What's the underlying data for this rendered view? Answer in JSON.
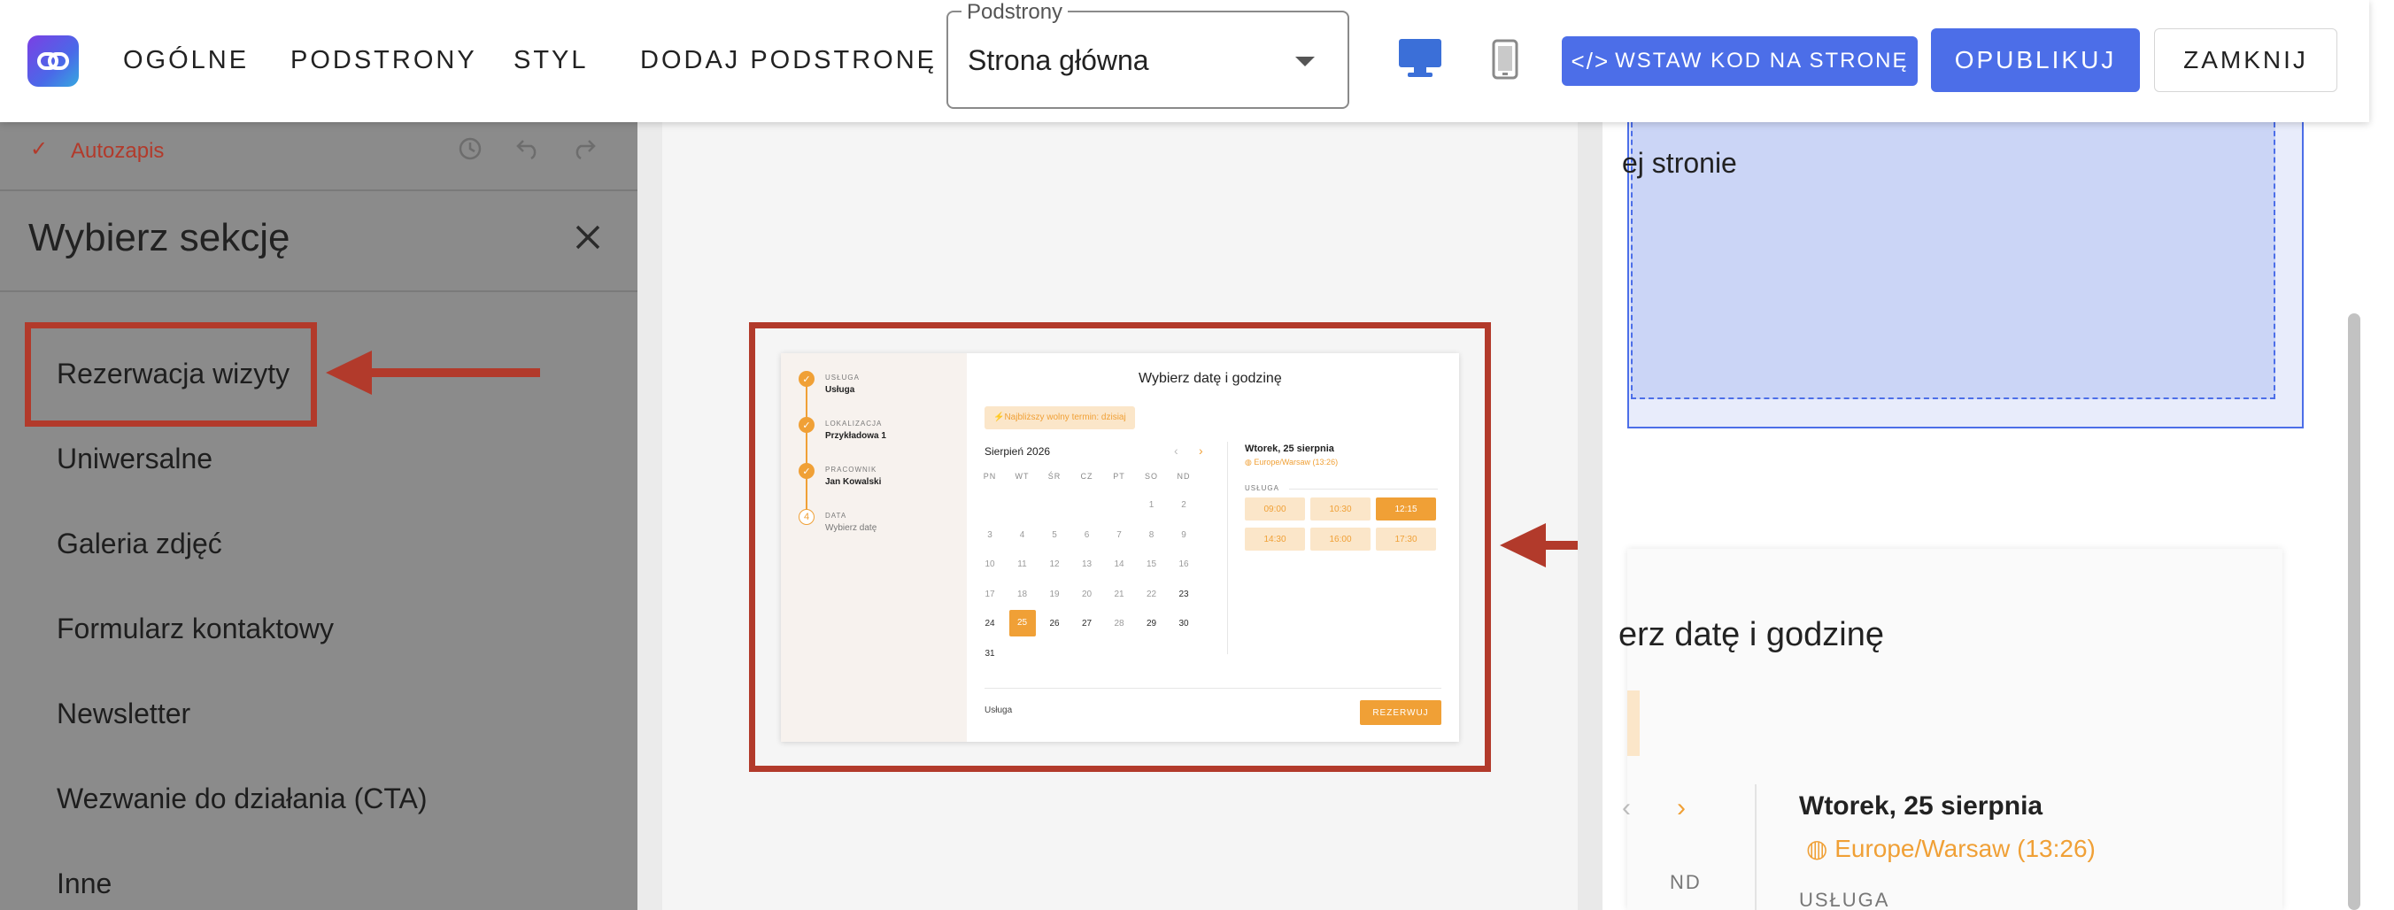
{
  "topbar": {
    "nav": [
      "OGÓLNE",
      "PODSTRONY",
      "STYL",
      "DODAJ PODSTRONĘ"
    ],
    "select_legend": "Podstrony",
    "select_value": "Strona główna",
    "embed_label": "WSTAW KOD NA STRONĘ",
    "publish_label": "OPUBLIKUJ",
    "close_label": "ZAMKNIJ"
  },
  "sidebar": {
    "autosave": "Autozapis",
    "title": "Wybierz sekcję",
    "items": [
      "Rezerwacja wizyty",
      "Uniwersalne",
      "Galeria zdjęć",
      "Formularz kontaktowy",
      "Newsletter",
      "Wezwanie do działania (CTA)",
      "Inne"
    ]
  },
  "preview": {
    "steps": [
      {
        "label": "USŁUGA",
        "value": "Usługa"
      },
      {
        "label": "LOKALIZACJA",
        "value": "Przykładowa 1"
      },
      {
        "label": "PRACOWNIK",
        "value": "Jan Kowalski"
      },
      {
        "label": "DATA",
        "value": "Wybierz datę",
        "num": "4"
      }
    ],
    "title": "Wybierz datę i godzinę",
    "nearest": "⚡Najbliższy wolny termin: dzisiaj",
    "month": "Sierpień 2026",
    "weekdays": [
      "PN",
      "WT",
      "ŚR",
      "CZ",
      "PT",
      "SO",
      "ND"
    ],
    "selected_date": "Wtorek, 25 sierpnia",
    "timezone": "Europe/Warsaw (13:26)",
    "service_label": "USŁUGA",
    "slots": [
      "09:00",
      "10:30",
      "12:15",
      "14:30",
      "16:00",
      "17:30"
    ],
    "footer_label": "Usługa",
    "reserve_label": "REZERWUJ"
  },
  "right_panel": {
    "text_fragment": "ej stronie",
    "heading_fragment": "erz datę i godzinę",
    "weekday_fragment": "ND",
    "date_heading": "Wtorek, 25 sierpnia",
    "timezone": "Europe/Warsaw (13:26)",
    "service_label": "USŁUGA"
  },
  "colors": {
    "accent": "#4c6ee8",
    "orange": "#f0a036",
    "highlight_red": "#b23a2b"
  }
}
